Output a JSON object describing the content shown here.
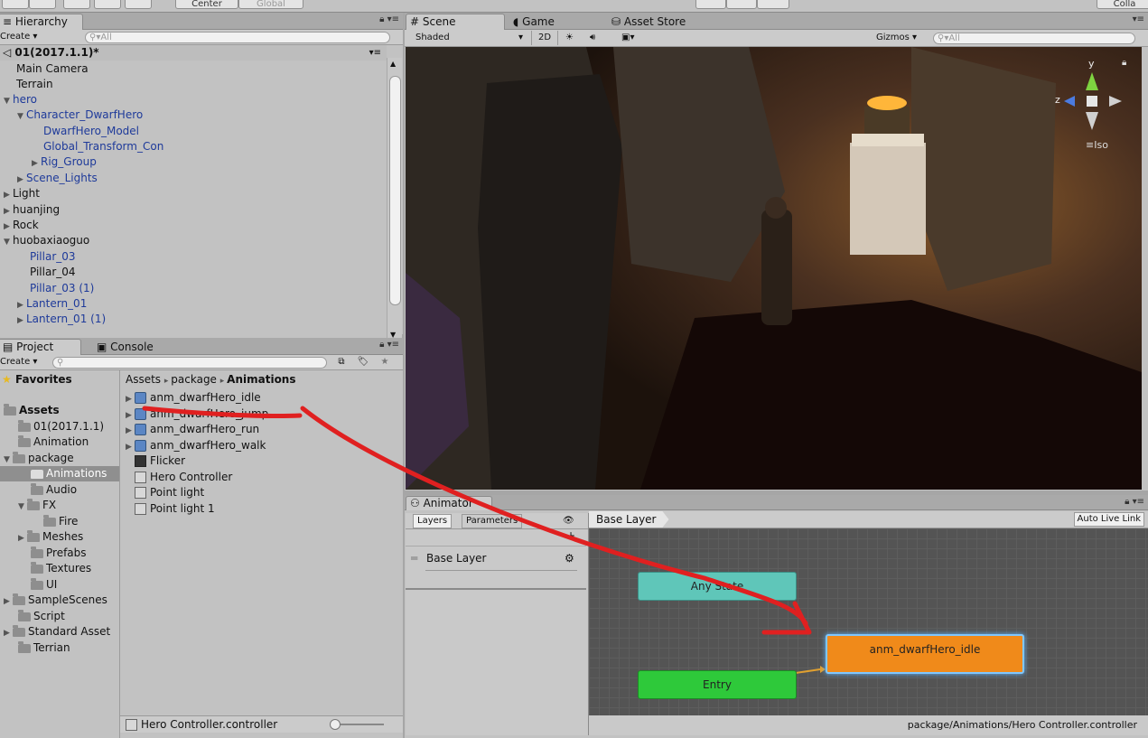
{
  "toolbar": {
    "center_label": "Center",
    "global_label": "Global",
    "right_label": "Colla"
  },
  "hierarchy": {
    "tab": "Hierarchy",
    "create": "Create",
    "search_placeholder": "All",
    "scene_name": "01(2017.1.1)*",
    "items": [
      {
        "label": "Main Camera"
      },
      {
        "label": "Terrain"
      },
      {
        "label": "hero"
      },
      {
        "label": "Character_DwarfHero"
      },
      {
        "label": "DwarfHero_Model"
      },
      {
        "label": "Global_Transform_Con"
      },
      {
        "label": "Rig_Group"
      },
      {
        "label": "Scene_Lights"
      },
      {
        "label": "Light"
      },
      {
        "label": "huanjing"
      },
      {
        "label": "Rock"
      },
      {
        "label": "huobaxiaoguo"
      },
      {
        "label": "Pillar_03"
      },
      {
        "label": "Pillar_04"
      },
      {
        "label": "Pillar_03 (1)"
      },
      {
        "label": "Lantern_01"
      },
      {
        "label": "Lantern_01 (1)"
      }
    ]
  },
  "project": {
    "tab_project": "Project",
    "tab_console": "Console",
    "create": "Create",
    "favorites": "Favorites",
    "tree": [
      {
        "label": "Assets"
      },
      {
        "label": "01(2017.1.1)"
      },
      {
        "label": "Animation"
      },
      {
        "label": "package"
      },
      {
        "label": "Animations"
      },
      {
        "label": "Audio"
      },
      {
        "label": "FX"
      },
      {
        "label": "Fire"
      },
      {
        "label": "Meshes"
      },
      {
        "label": "Prefabs"
      },
      {
        "label": "Textures"
      },
      {
        "label": "UI"
      },
      {
        "label": "SampleScenes"
      },
      {
        "label": "Script"
      },
      {
        "label": "Standard Asset"
      },
      {
        "label": "Terrian"
      }
    ],
    "breadcrumb": [
      "Assets",
      "package",
      "Animations"
    ],
    "assets": [
      {
        "label": "anm_dwarfHero_idle"
      },
      {
        "label": "anm_dwarfHero_jump"
      },
      {
        "label": "anm_dwarfHero_run"
      },
      {
        "label": "anm_dwarfHero_walk"
      },
      {
        "label": "Flicker"
      },
      {
        "label": "Hero Controller"
      },
      {
        "label": "Point light"
      },
      {
        "label": "Point light 1"
      }
    ],
    "footer": "Hero Controller.controller"
  },
  "scene": {
    "tabs": [
      "Scene",
      "Game",
      "Asset Store"
    ],
    "shading": "Shaded",
    "mode_2d": "2D",
    "gizmos": "Gizmos",
    "search_placeholder": "All",
    "gizmo_y": "y",
    "gizmo_z": "z",
    "projection": "Iso"
  },
  "animator": {
    "tab": "Animator",
    "tab_layers": "Layers",
    "tab_parameters": "Parameters",
    "layer_name": "Base Layer",
    "breadcrumb": "Base Layer",
    "auto_live": "Auto Live Link",
    "nodes": {
      "any_state": "Any State",
      "entry": "Entry",
      "idle": "anm_dwarfHero_idle"
    },
    "footer_path": "package/Animations/Hero Controller.controller"
  },
  "colors": {
    "any_state": "#5fc6b9",
    "entry": "#2ec93a",
    "default_state": "#f08a1a",
    "annotation": "#e02020"
  }
}
